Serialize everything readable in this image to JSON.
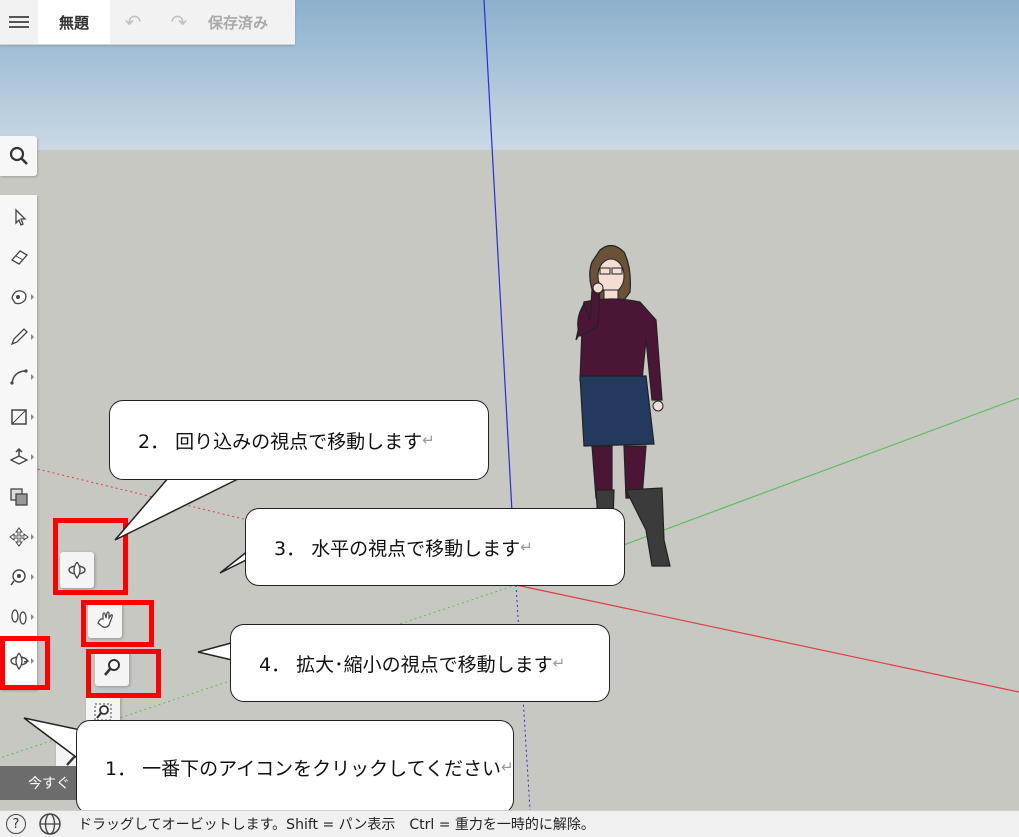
{
  "topbar": {
    "title": "無題",
    "undo_icon": "↶",
    "redo_icon": "↷",
    "save_status": "保存済み"
  },
  "tools": [
    "search-icon",
    "select-icon",
    "eraser-icon",
    "paint-bucket-icon",
    "pencil-icon",
    "arc-icon",
    "rectangle-icon",
    "push-pull-icon",
    "offset-icon",
    "move-icon",
    "tape-measure-icon",
    "walk-icon",
    "orbit-icon"
  ],
  "callouts": {
    "c1": "1．  一番下のアイコンをクリックしてください",
    "c2": "2．  回り込みの視点で移動します",
    "c3": "3．  水平の視点で移動します",
    "c4": "4．  拡大･縮小の視点で移動します",
    "return_mark": "↵"
  },
  "bottom": {
    "now_button": "今すぐ",
    "help": "?",
    "status": "ドラッグしてオービットします。Shift = パン表示　Ctrl = 重力を一時的に解除。"
  },
  "colors": {
    "highlight": "#ff0000",
    "axis_blue": "#2b2bd9",
    "axis_green": "#5cc05c",
    "axis_red": "#d94040"
  }
}
